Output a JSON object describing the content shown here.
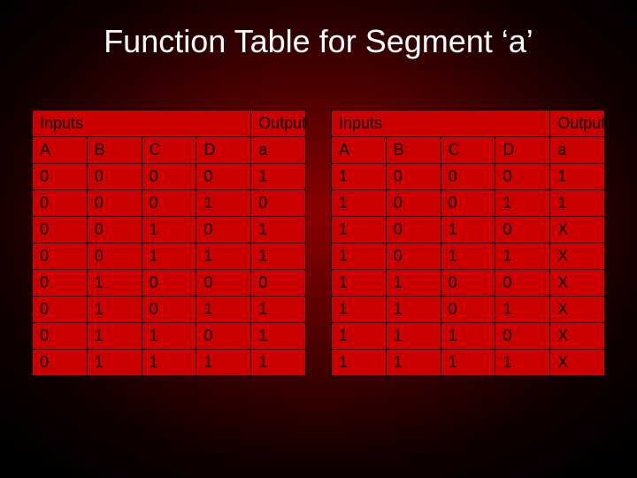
{
  "title": "Function Table for Segment ‘a’",
  "left": {
    "group_labels": {
      "inputs": "Inputs",
      "output": "Output"
    },
    "headers": [
      "A",
      "B",
      "C",
      "D",
      "a"
    ],
    "rows": [
      [
        "0",
        "0",
        "0",
        "0",
        "1"
      ],
      [
        "0",
        "0",
        "0",
        "1",
        "0"
      ],
      [
        "0",
        "0",
        "1",
        "0",
        "1"
      ],
      [
        "0",
        "0",
        "1",
        "1",
        "1"
      ],
      [
        "0",
        "1",
        "0",
        "0",
        "0"
      ],
      [
        "0",
        "1",
        "0",
        "1",
        "1"
      ],
      [
        "0",
        "1",
        "1",
        "0",
        "1"
      ],
      [
        "0",
        "1",
        "1",
        "1",
        "1"
      ]
    ]
  },
  "right": {
    "group_labels": {
      "inputs": "Inputs",
      "output": "Output"
    },
    "headers": [
      "A",
      "B",
      "C",
      "D",
      "a"
    ],
    "rows": [
      [
        "1",
        "0",
        "0",
        "0",
        "1"
      ],
      [
        "1",
        "0",
        "0",
        "1",
        "1"
      ],
      [
        "1",
        "0",
        "1",
        "0",
        "X"
      ],
      [
        "1",
        "0",
        "1",
        "1",
        "X"
      ],
      [
        "1",
        "1",
        "0",
        "0",
        "X"
      ],
      [
        "1",
        "1",
        "0",
        "1",
        "X"
      ],
      [
        "1",
        "1",
        "1",
        "0",
        "X"
      ],
      [
        "1",
        "1",
        "1",
        "1",
        "X"
      ]
    ]
  }
}
